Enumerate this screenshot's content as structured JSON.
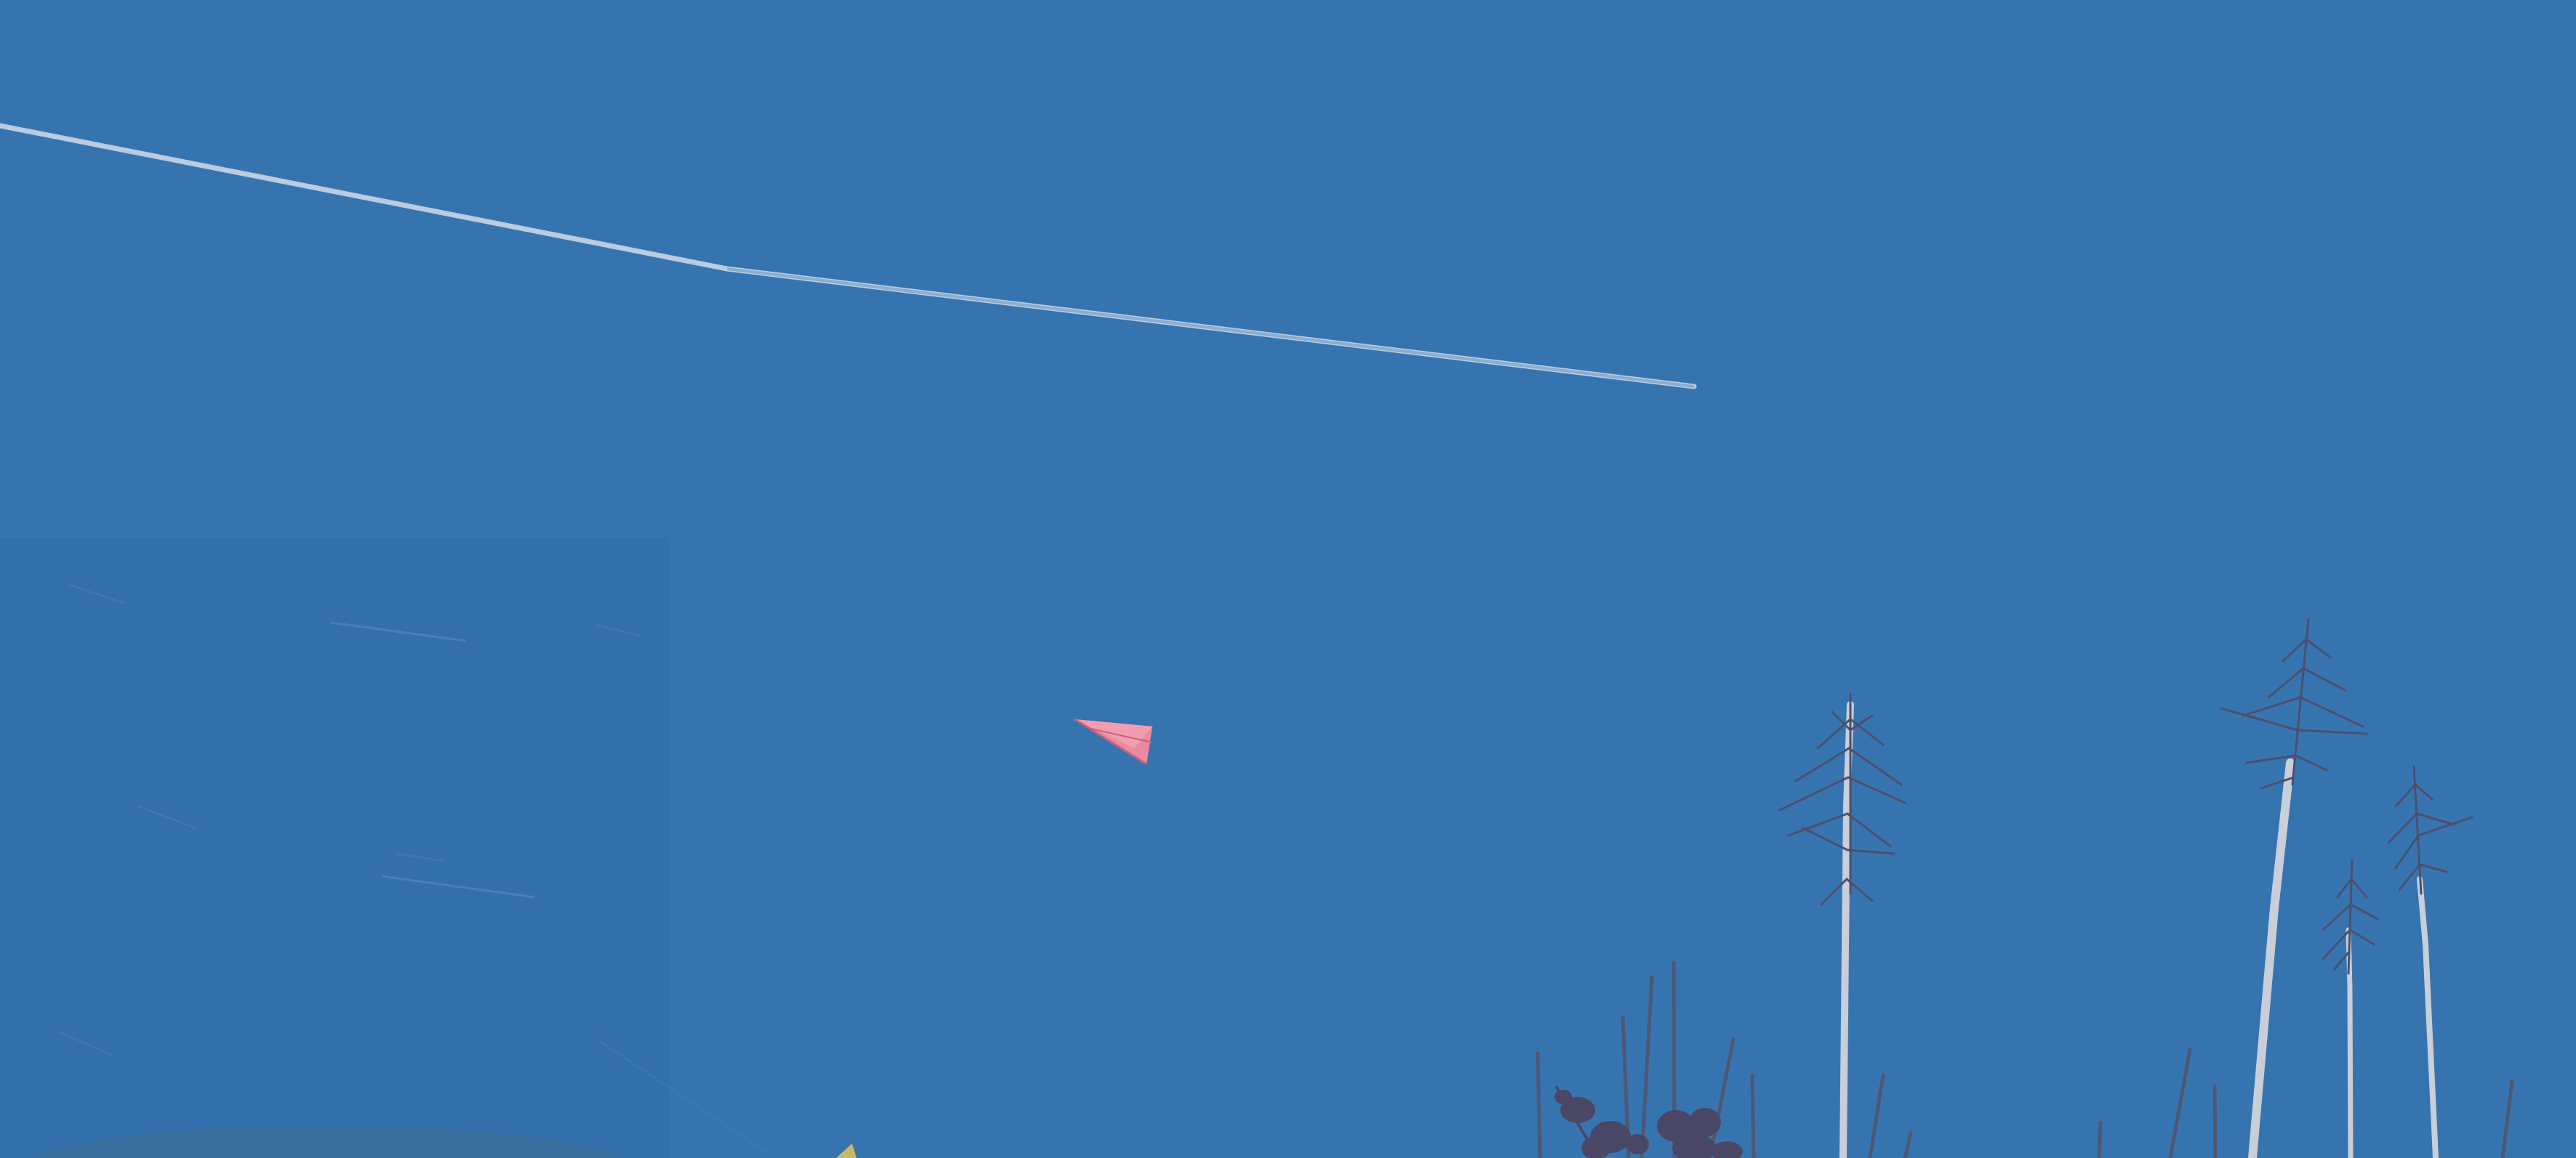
{
  "scene": {
    "kind": "desktop-wallpaper",
    "description_elements": [
      "sky",
      "contrail",
      "paper-plane",
      "grass-stems",
      "dark-flowers"
    ],
    "colors": {
      "sky": "#3674b0",
      "sky_shade": "#326ea8",
      "contrail": "#c9d6e6",
      "paper_plane": "#e98aa0",
      "paper_plane_fold": "#c75f7a",
      "stem": "#c8cfd8",
      "branch": "#4b4f6e",
      "flower": "#4a4766",
      "grass": "#4d5775"
    }
  }
}
